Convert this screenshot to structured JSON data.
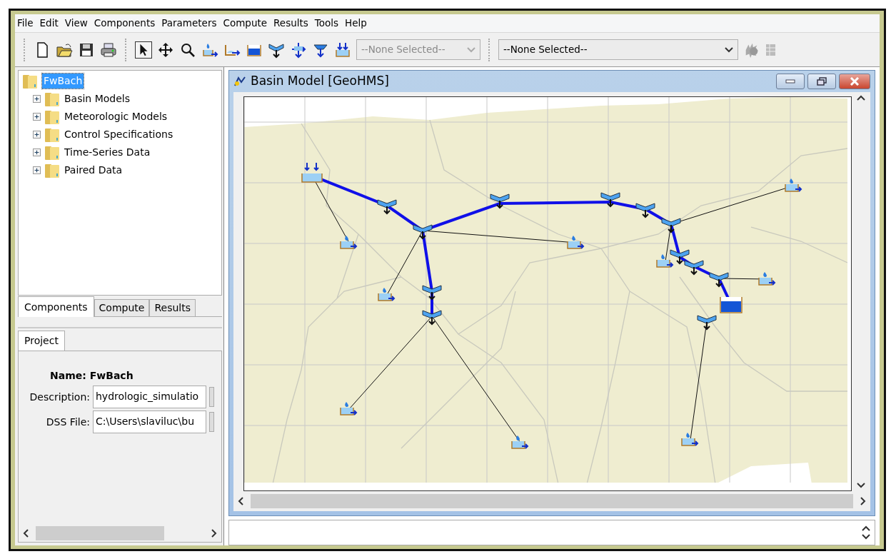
{
  "menu": [
    "File",
    "Edit",
    "View",
    "Components",
    "Parameters",
    "Compute",
    "Results",
    "Tools",
    "Help"
  ],
  "toolbar": {
    "element_select": {
      "value": "--None Selected--",
      "disabled": true
    },
    "run_select": {
      "value": "--None Selected--",
      "disabled": false
    }
  },
  "tree": {
    "label": "FwBach",
    "selected": true,
    "children": [
      {
        "label": "Basin Models",
        "expanded": false
      },
      {
        "label": "Meteorologic Models",
        "expanded": false
      },
      {
        "label": "Control Specifications",
        "expanded": false
      },
      {
        "label": "Time-Series Data",
        "expanded": false
      },
      {
        "label": "Paired Data",
        "expanded": false
      }
    ]
  },
  "explorer_tabs": [
    {
      "label": "Components",
      "selected": true
    },
    {
      "label": "Compute",
      "selected": false
    },
    {
      "label": "Results",
      "selected": false
    }
  ],
  "component_editor": {
    "tabs": [
      {
        "label": "Project",
        "selected": true
      }
    ],
    "name": "Name: FwBach",
    "fields": [
      {
        "label": "Description:",
        "value": "hydrologic_simulatio"
      },
      {
        "label": "DSS File:",
        "value": "C:\\Users\\slaviluc\\bu"
      }
    ]
  },
  "basin_window": {
    "title": "Basin Model [GeoHMS]"
  }
}
